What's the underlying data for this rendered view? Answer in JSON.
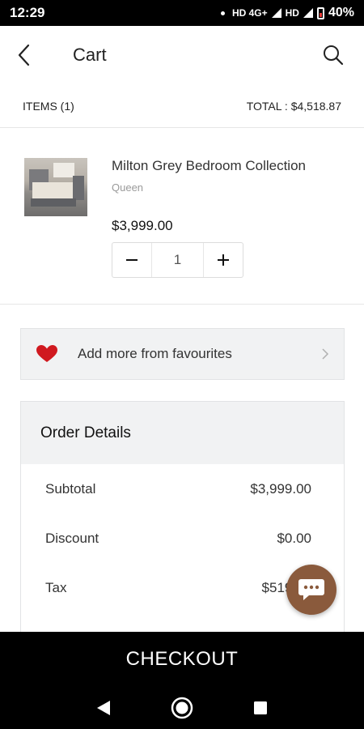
{
  "status_bar": {
    "time": "12:29",
    "network": "HD 4G+",
    "network2": "HD",
    "battery": "40%"
  },
  "header": {
    "title": "Cart",
    "back_icon": "chevron-left-icon",
    "search_icon": "search-icon"
  },
  "summary": {
    "items": "ITEMS (1)",
    "total": "TOTAL : $4,518.87"
  },
  "cart_items": [
    {
      "name": "Milton Grey Bedroom Collection",
      "variant": "Queen",
      "price": "$3,999.00",
      "quantity": "1",
      "decrement_symbol": "−",
      "increment_symbol": "+"
    }
  ],
  "favourites": {
    "label": "Add more from favourites",
    "icon": "heart-icon",
    "icon_color": "#d0191f"
  },
  "order_details": {
    "title": "Order Details",
    "lines": [
      {
        "label": "Subtotal",
        "value": "$3,999.00"
      },
      {
        "label": "Discount",
        "value": "$0.00"
      },
      {
        "label": "Tax",
        "value": "$519.87"
      }
    ]
  },
  "checkout": {
    "label": "CHECKOUT"
  },
  "chat": {
    "icon": "chat-bubble-icon",
    "color": "#8a5a3c"
  },
  "colors": {
    "accent": "#000000",
    "panel": "#f1f2f3"
  }
}
